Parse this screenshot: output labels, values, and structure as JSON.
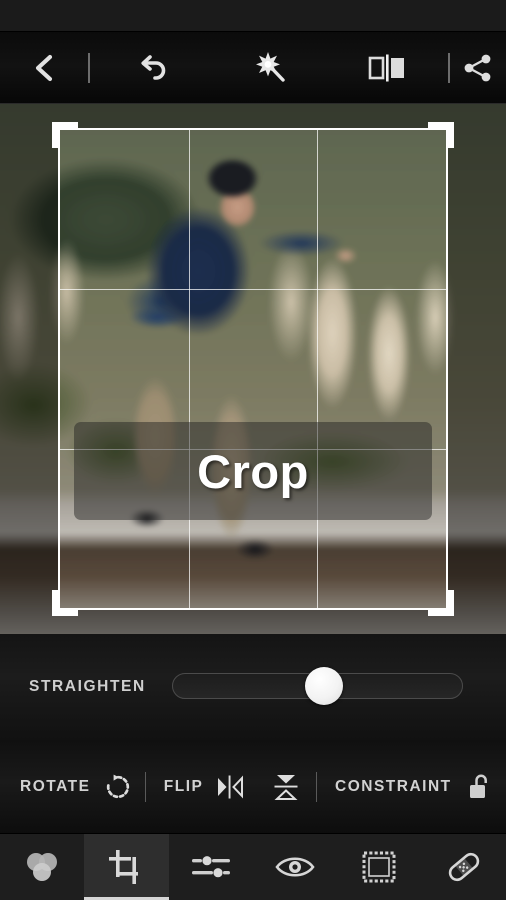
{
  "app": {
    "tool_label": "Crop",
    "accent_color": "#ffffff",
    "panel_color": "#1b1b1b"
  },
  "topbar": {
    "back_label": "Back",
    "undo_label": "Undo",
    "auto_enhance_label": "Auto Enhance",
    "compare_label": "Before / After",
    "share_label": "Share",
    "icons": {
      "back": "chevron-left-icon",
      "undo": "undo-icon",
      "auto": "magic-wand-icon",
      "compare": "before-after-icon",
      "share": "share-icon"
    }
  },
  "stage": {
    "overlay_label": "Crop",
    "grid": "rule-of-thirds",
    "photo_alt": "Skateboarder doing a trick on a concrete ledge, motion-blurred background with pampas grass"
  },
  "controls": {
    "straighten_label": "STRAIGHTEN",
    "straighten_value": 50,
    "rotate_label": "ROTATE",
    "flip_label": "FLIP",
    "constraint_label": "CONSTRAINT",
    "constraint_state": "unlocked",
    "icons": {
      "rotate": "rotate-cw-icon",
      "flip_horizontal": "flip-horizontal-icon",
      "flip_vertical": "flip-vertical-icon",
      "constraint_lock": "lock-open-icon",
      "slider_knob": "slider-knob"
    }
  },
  "tabbar": {
    "tabs": [
      {
        "id": "looks",
        "label": "Looks",
        "icon": "color-circles-icon",
        "active": false
      },
      {
        "id": "crop",
        "label": "Crop",
        "icon": "crop-icon",
        "active": true
      },
      {
        "id": "adjust",
        "label": "Adjust",
        "icon": "sliders-icon",
        "active": false
      },
      {
        "id": "redeye",
        "label": "Red Eye",
        "icon": "eye-icon",
        "active": false
      },
      {
        "id": "borders",
        "label": "Borders",
        "icon": "frame-icon",
        "active": false
      },
      {
        "id": "blemish",
        "label": "Blemish",
        "icon": "bandage-icon",
        "active": false
      }
    ]
  }
}
